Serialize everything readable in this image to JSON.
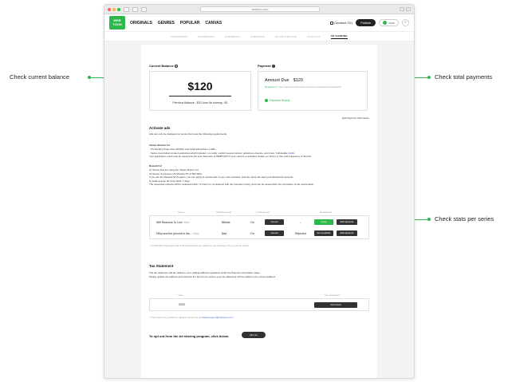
{
  "callouts": {
    "left": "Check current balance",
    "right_top": "Check total payments",
    "right_bottom": "Check stats per series",
    "accent": "#2eb84b"
  },
  "browser": {
    "url": "webtoon.com"
  },
  "header": {
    "logo": "WEB TOON",
    "menu": [
      "ORIGINALS",
      "GENRES",
      "POPULAR",
      "CANVAS"
    ],
    "creators": "Creators 101",
    "publish": "Publish",
    "user": "WEBI",
    "search_icon": "search-icon"
  },
  "subnav": {
    "items": [
      "DASHBOARD",
      "DASHBOARD",
      "COMMENTS",
      "CREATORS",
      "AD PROTECTION",
      "ACCOUNT",
      "AD SHARING"
    ],
    "active_index": 6
  },
  "balance": {
    "label": "Current Balance",
    "amount": "$120",
    "detail": "Previous Balance : $30    June Ad sharing : $0"
  },
  "payment": {
    "label": "Payment",
    "due_label": "Amount Due",
    "due_value": "$120",
    "note_green": "Registered",
    "note": " / Your Payment Information has been registered successfully.",
    "history": "Payment History",
    "edit": "Edit Payment Information"
  },
  "activate": {
    "title": "Activate ads",
    "intro": "Ads can only be displayed on series that meet the following requirements.",
    "viewer_title": "Viewer Bottom Ad",
    "viewer_lines": [
      "- US Monthly Page View 40,000+ and Total Subscribers 1,000+",
      "- Series must follow content guidelines which includes: no nudity, explicit sexual content, gratuitous violence, and more. Full details",
      "Your application result may be rejected at the sole discretion of WEBTOON if your content or activities violate our Terms of Use and Frequency of Service."
    ],
    "viewer_link": "HERE",
    "reward_title": "Reward Ad",
    "reward_lines": [
      "(1) Series that are using the Viewer Bottom Ad",
      "(2) Series of previous US Monthly PV of 500,000+",
      "If you join the Reward Ad Program, you can apply to expose ads in your new episodes, and the users can read your Reward Ad episode",
      "by looking at an ad once within 7 days.",
      "The requested episode will be reviewed within 72 hours for compliance with the operation policy, and may be issued after the completion of the examination."
    ]
  },
  "series_table": {
    "headers": [
      "Series",
      "Total Revenue",
      "In Viewer Ad",
      "Reward Ad"
    ],
    "rows": [
      {
        "name": "969 Reasons To Live",
        "sub": "Stats",
        "revenue": "$Mode",
        "status": "On",
        "viewer_btn": "Cancel",
        "dash": "-",
        "reward_btn": "Apply",
        "edit": "Edit Episode"
      },
      {
        "name": "Dilky and the princes in dis...",
        "sub": "Stats",
        "revenue": "$Ad",
        "status": "On",
        "viewer_btn": "Cancel",
        "dash": "Rejected",
        "reward_btn": "Not Available",
        "edit": "Edit Episode"
      }
    ],
    "note": "* US Monthly Pageview and Total Subscribers are based on the last day of the previous month."
  },
  "tax": {
    "title": "Tax Statement",
    "lines": [
      "The tax statement will be mailed to your mailing address registered under the Payment Information page.",
      "Please update the address and resubmit the tax form to ensure your tax statement will be mailed to the correct address."
    ],
    "headers": [
      "Year",
      "Tax Statement"
    ],
    "year": "2020",
    "download": "Download",
    "note": "* If you have any questions, please contact us at",
    "email": "creatorsupport@webtoon.com"
  },
  "optout": {
    "text": "To opt out from the Ad sharing program, click below.",
    "button": "Opt out"
  }
}
